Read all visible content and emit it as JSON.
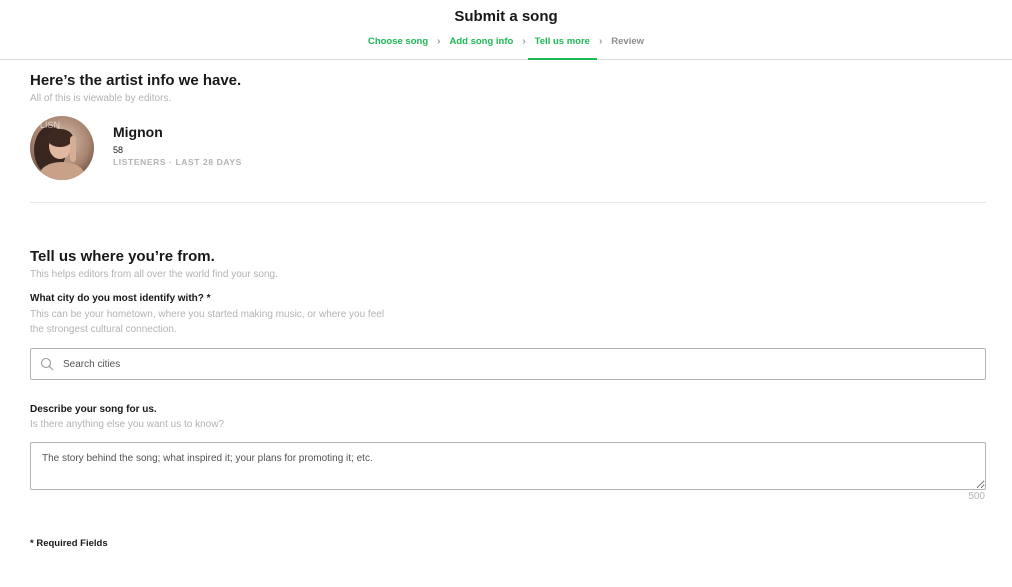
{
  "header": {
    "title": "Submit a song",
    "steps": [
      {
        "label": "Choose song",
        "state": "done"
      },
      {
        "label": "Add song info",
        "state": "done"
      },
      {
        "label": "Tell us more",
        "state": "current"
      },
      {
        "label": "Review",
        "state": "pending"
      }
    ],
    "step_separator_icon": "chevron-right-icon"
  },
  "artist_section": {
    "title": "Here’s the artist info we have.",
    "subtitle": "All of this is viewable by editors.",
    "artist": {
      "name": "Mignon",
      "listeners": "58",
      "listeners_label": "LISTENERS · LAST 28 DAYS",
      "avatar_icon": "artist-avatar-photo"
    }
  },
  "location_section": {
    "title": "Tell us where you’re from.",
    "subtitle": "This helps editors from all over the world find your song.",
    "city_label": "What city do you most identify with? *",
    "city_help": "This can be your hometown, where you started making music, or where you feel the strongest cultural connection.",
    "search_placeholder": "Search cities",
    "search_value": ""
  },
  "description_section": {
    "label": "Describe your song for us.",
    "help": "Is there anything else you want us to know?",
    "placeholder": "The story behind the song; what inspired it; your plans for promoting it; etc.",
    "value": "",
    "char_limit": "500"
  },
  "footer": {
    "required_note": "* Required Fields"
  },
  "colors": {
    "accent": "#1db954",
    "text": "#181818",
    "muted": "#b3b3b3",
    "border": "#b3b3b3"
  }
}
